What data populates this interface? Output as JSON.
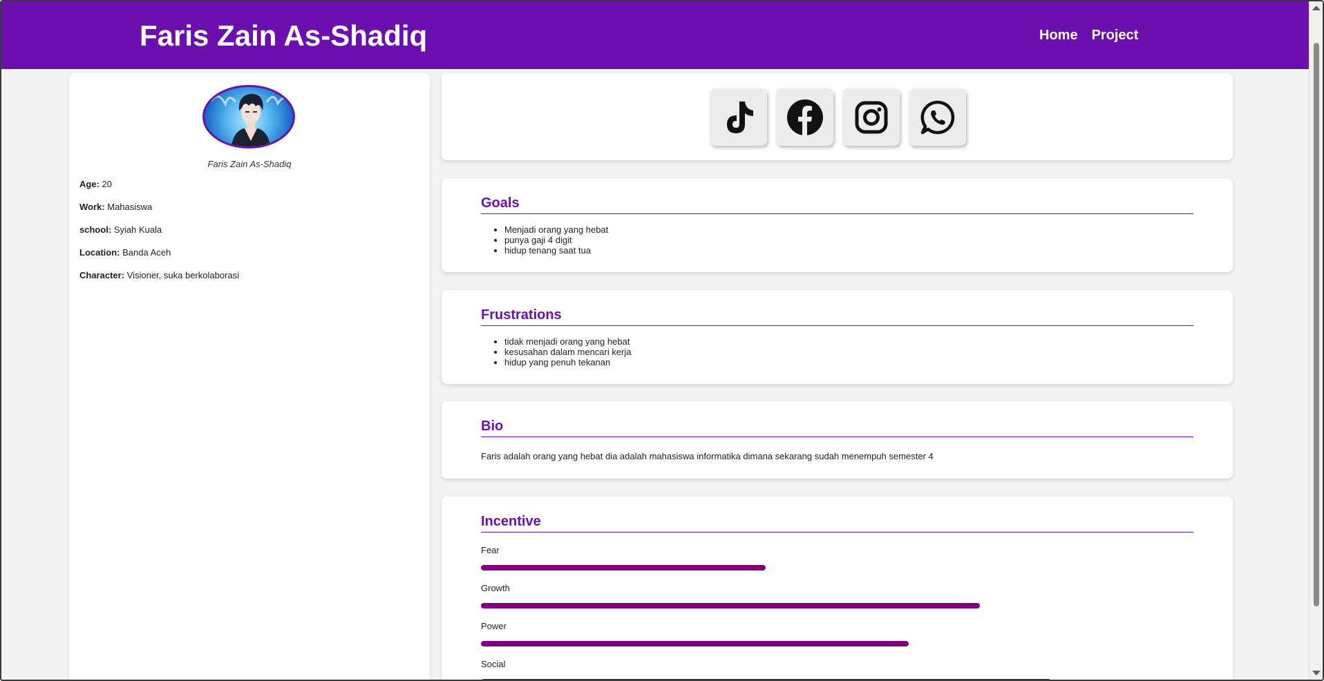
{
  "header": {
    "title": "Faris Zain As-Shadiq",
    "nav": [
      "Home",
      "Project"
    ]
  },
  "profile": {
    "caption": "Faris Zain As-Shadiq",
    "rows": [
      {
        "label": "Age:",
        "value": "20"
      },
      {
        "label": "Work:",
        "value": "Mahasiswa"
      },
      {
        "label": "school:",
        "value": "Syiah Kuala"
      },
      {
        "label": "Location:",
        "value": "Banda Aceh"
      },
      {
        "label": "Character:",
        "value": "Visioner, suka berkolaborasi"
      }
    ]
  },
  "social": {
    "icons": [
      "tiktok-icon",
      "facebook-icon",
      "instagram-icon",
      "whatsapp-icon"
    ]
  },
  "goals": {
    "title": "Goals",
    "items": [
      "Menjadi orang yang hebat",
      "punya gaji 4 digit",
      "hidup tenang saat tua"
    ]
  },
  "frustrations": {
    "title": "Frustrations",
    "items": [
      "tidak menjadi orang yang hebat",
      "kesusahan dalam mencari kerja",
      "hidup yang penuh tekanan"
    ]
  },
  "bio": {
    "title": "Bio",
    "text": "Faris adalah orang yang hebat dia adalah mahasiswa informatika dimana sekarang sudah menempuh semester 4"
  },
  "incentive": {
    "title": "Incentive",
    "bar_color": "#800080",
    "bars": [
      {
        "label": "Fear",
        "level": 0.4
      },
      {
        "label": "Growth",
        "level": 0.7
      },
      {
        "label": "Power",
        "level": 0.6
      },
      {
        "label": "Social",
        "level": 0.8
      }
    ]
  },
  "colors": {
    "accent": "#6b0fae",
    "background": "#f3f3f3"
  }
}
